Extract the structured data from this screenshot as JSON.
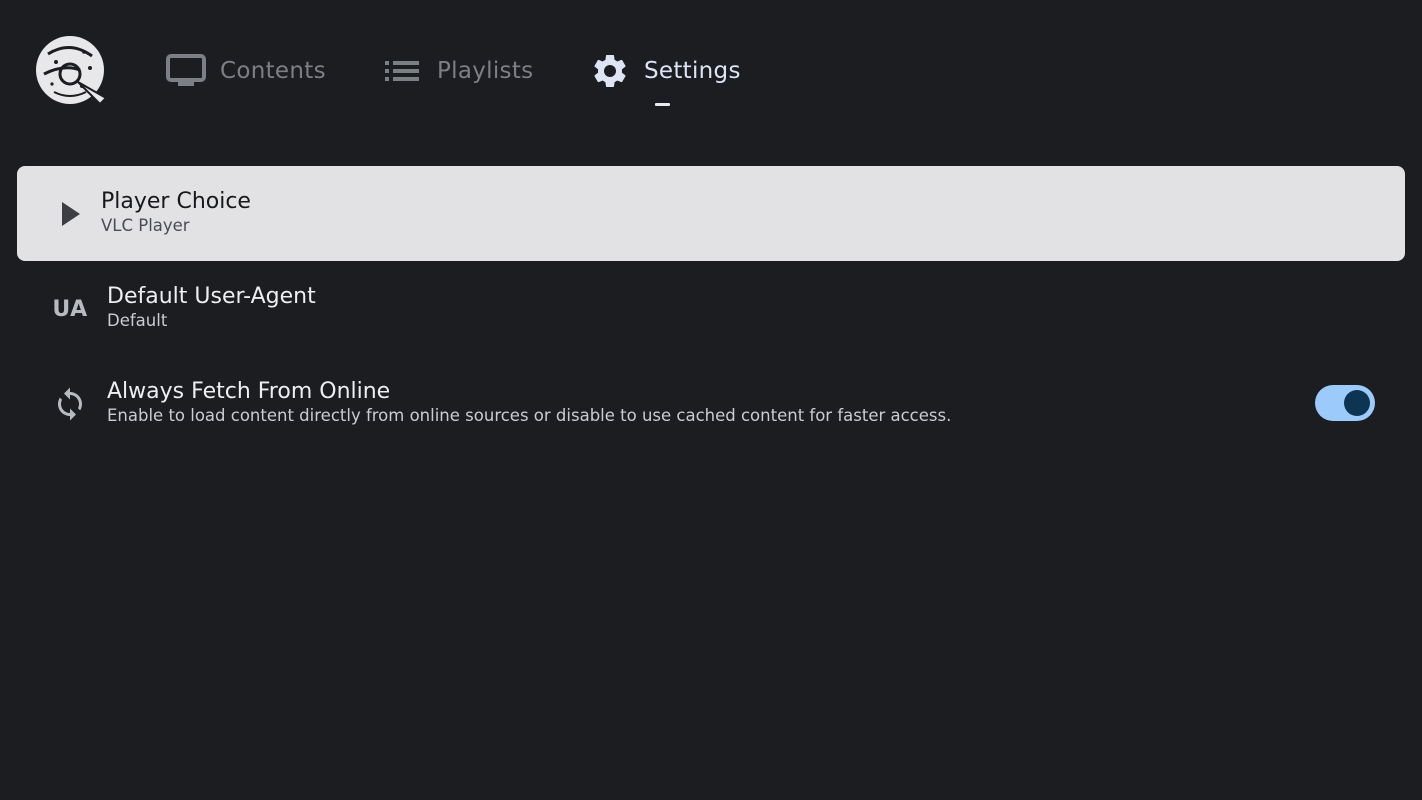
{
  "nav": {
    "tabs": [
      {
        "label": "Contents",
        "icon": "tv-icon",
        "active": false
      },
      {
        "label": "Playlists",
        "icon": "list-icon",
        "active": false
      },
      {
        "label": "Settings",
        "icon": "gear-icon",
        "active": true
      }
    ]
  },
  "settings": {
    "items": [
      {
        "title": "Player Choice",
        "subtitle": "VLC Player",
        "icon": "play-icon",
        "focused": true
      },
      {
        "title": "Default User-Agent",
        "subtitle": "Default",
        "icon_text": "UA",
        "icon": "ua-icon"
      },
      {
        "title": "Always Fetch From Online",
        "subtitle": "Enable to load content directly from online sources or disable to use cached content for faster access.",
        "icon": "sync-icon",
        "toggle_on": true
      }
    ]
  },
  "colors": {
    "background": "#1c1d20",
    "focused_row": "#e2e2e4",
    "toggle_track": "#9ccbfb",
    "toggle_knob": "#0e3453",
    "active_tab": "#dce4f6",
    "inactive_tab": "#7c7f86"
  }
}
